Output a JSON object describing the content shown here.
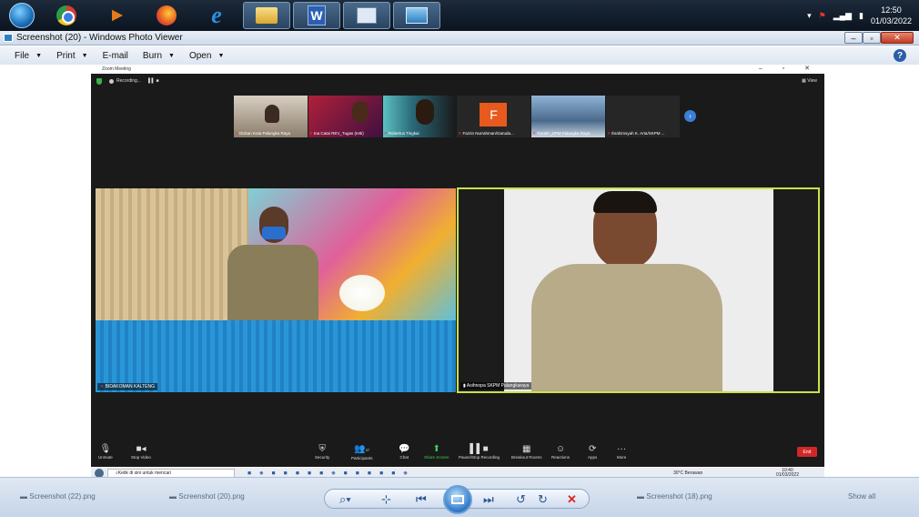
{
  "taskbar": {
    "clock_time": "12:50",
    "clock_date": "01/03/2022",
    "word_label": "W"
  },
  "window": {
    "title": "Screenshot (20) - Windows Photo Viewer"
  },
  "menu": {
    "file": "File",
    "print": "Print",
    "email": "E-mail",
    "burn": "Burn",
    "open": "Open",
    "help": "?"
  },
  "zoom": {
    "title": "Zoom Meeting",
    "recording": "Recording...",
    "view_label": "View",
    "participants": [
      {
        "label": "Diskan Kota Palangka Raya"
      },
      {
        "label": "Ina Catai REV_Tugas (Ietti)"
      },
      {
        "label": "Robertus Tingkai"
      },
      {
        "label": "Fazrin Nurrahman/Garuda..."
      },
      {
        "label": "TorotiF_DPM Palangka Raya"
      },
      {
        "label": "Ibrahimsyah K. Arta/SKPM ..."
      }
    ],
    "thumb_f_letter": "F",
    "tile_left_label": "BIDAKOMAN KALTENG",
    "tile_right_label": "Asihnopa SKPM Palangkaraya",
    "controls": {
      "unmute": "Unmute",
      "stop_video": "Stop Video",
      "security": "Security",
      "participants": "Participants",
      "participants_count": "37",
      "chat": "Chat",
      "share_screen": "Share Screen",
      "pause_recording": "Pause/Stop Recording",
      "breakout": "Breakout Rooms",
      "reactions": "Reactions",
      "apps": "Apps",
      "more": "More",
      "end": "End"
    }
  },
  "inner_taskbar": {
    "search_placeholder": "Ketik di sini untuk mencari",
    "weather": "30°C Berawan",
    "time": "10:40",
    "date": "01/03/2022"
  },
  "viewer_strip": {
    "left1": "Screenshot (22).png",
    "left2": "Screenshot (20).png",
    "right1": "Screenshot (18).png",
    "right2": "Show all"
  },
  "colors": {
    "active_speaker_border": "#c8e24a",
    "end_button": "#d32727",
    "zoom_bg": "#1a1a1a"
  }
}
